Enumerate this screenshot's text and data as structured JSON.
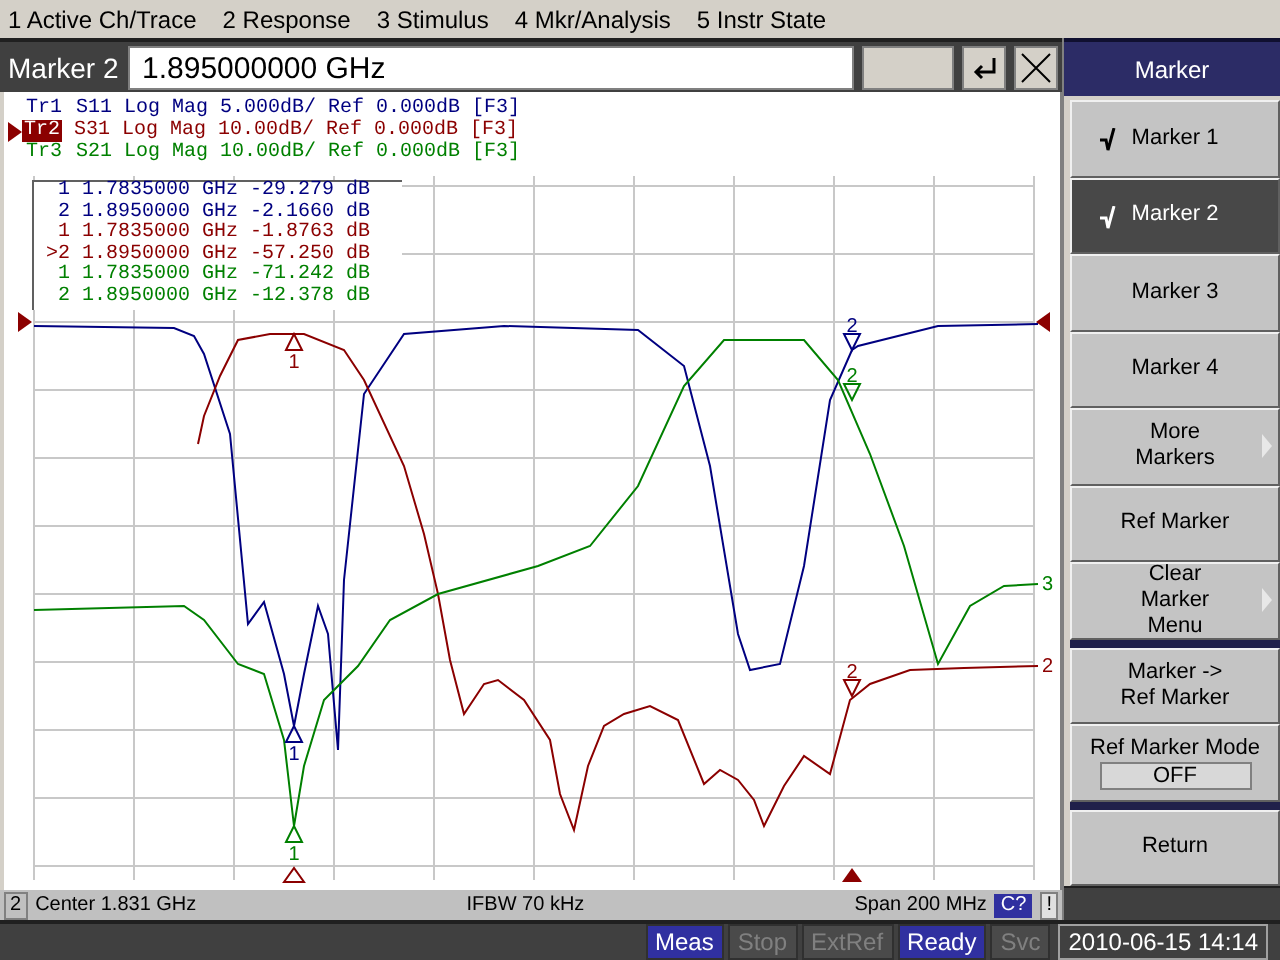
{
  "menu": [
    "1 Active Ch/Trace",
    "2 Response",
    "3 Stimulus",
    "4 Mkr/Analysis",
    "5 Instr State"
  ],
  "entry": {
    "label": "Marker 2",
    "value": "1.895000000 GHz"
  },
  "traces": [
    {
      "name": "Tr1",
      "text": "S11 Log Mag 5.000dB/ Ref 0.000dB [F3]",
      "color": "#000080",
      "active": false,
      "markers": [
        "1",
        "2"
      ]
    },
    {
      "name": "Tr2",
      "text": "S31 Log Mag 10.00dB/ Ref 0.000dB [F3]",
      "color": "#8b0000",
      "active": true,
      "markers": [
        "1",
        "2"
      ]
    },
    {
      "name": "Tr3",
      "text": "S21 Log Mag 10.00dB/ Ref 0.000dB [F3]",
      "color": "#008000",
      "active": false,
      "markers": [
        "1",
        "2"
      ]
    }
  ],
  "marker_table": [
    {
      "label": "1",
      "freq": "1.7835000 GHz",
      "value": "-29.279 dB",
      "color": "#000080"
    },
    {
      "label": "2",
      "freq": "1.8950000 GHz",
      "value": "-2.1660 dB",
      "color": "#000080"
    },
    {
      "label": "1",
      "freq": "1.7835000 GHz",
      "value": "-1.8763 dB",
      "color": "#8b0000"
    },
    {
      "label": ">2",
      "freq": "1.8950000 GHz",
      "value": "-57.250 dB",
      "color": "#8b0000"
    },
    {
      "label": "1",
      "freq": "1.7835000 GHz",
      "value": "-71.242 dB",
      "color": "#008000"
    },
    {
      "label": "2",
      "freq": "1.8950000 GHz",
      "value": "-12.378 dB",
      "color": "#008000"
    }
  ],
  "end_labels": [
    {
      "label": "3",
      "color": "#008000"
    },
    {
      "label": "2",
      "color": "#8b0000"
    }
  ],
  "channel_bar": {
    "channel": "2",
    "center": "Center 1.831 GHz",
    "ifbw": "IFBW 70 kHz",
    "span": "Span 200 MHz",
    "cal": "C?",
    "warning": "!"
  },
  "softkeys": {
    "title": "Marker",
    "items": [
      {
        "kind": "key",
        "label": "Marker 1",
        "checked": true,
        "selected": false,
        "submenu": false
      },
      {
        "kind": "key",
        "label": "Marker 2",
        "checked": true,
        "selected": true,
        "submenu": false
      },
      {
        "kind": "key",
        "label": "Marker 3",
        "checked": false,
        "selected": false,
        "submenu": false
      },
      {
        "kind": "key",
        "label": "Marker 4",
        "checked": false,
        "selected": false,
        "submenu": false
      },
      {
        "kind": "key",
        "label": "More Markers",
        "checked": false,
        "selected": false,
        "submenu": true
      },
      {
        "kind": "key",
        "label": "Ref Marker",
        "checked": false,
        "selected": false,
        "submenu": false
      },
      {
        "kind": "key",
        "label": "Clear Marker Menu",
        "checked": false,
        "selected": false,
        "submenu": true
      },
      {
        "kind": "separator"
      },
      {
        "kind": "key",
        "label": "Marker -> Ref Marker",
        "checked": false,
        "selected": false,
        "submenu": false
      },
      {
        "kind": "value_key",
        "label": "Ref Marker Mode",
        "value": "OFF",
        "checked": false,
        "selected": false,
        "submenu": false
      },
      {
        "kind": "separator"
      },
      {
        "kind": "key",
        "label": "Return",
        "checked": false,
        "selected": false,
        "submenu": false
      }
    ]
  },
  "status": [
    {
      "label": "Meas",
      "on": true
    },
    {
      "label": "Stop",
      "on": false
    },
    {
      "label": "ExtRef",
      "on": false
    },
    {
      "label": "Ready",
      "on": true
    },
    {
      "label": "Svc",
      "on": false
    }
  ],
  "clock": "2010-06-15 14:14"
}
